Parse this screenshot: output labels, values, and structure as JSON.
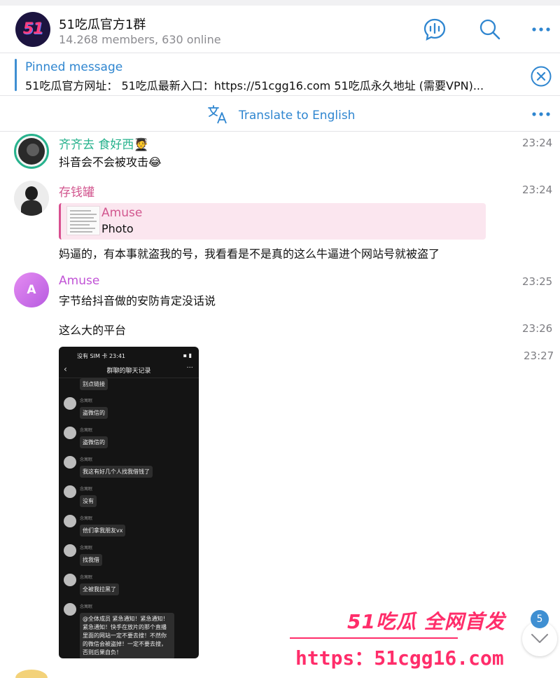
{
  "header": {
    "logo_text": "51",
    "title": "51吃瓜官方1群",
    "subtitle": "14.268 members, 630 online",
    "icons": [
      "voice-chat-icon",
      "search-icon",
      "more-icon"
    ]
  },
  "pinned": {
    "title": "Pinned message",
    "text": "51吃瓜官方网址： 51吃瓜最新入口：https://51cgg16.com 51吃瓜永久地址 (需要VPN)..."
  },
  "translate": {
    "label": "Translate to English"
  },
  "messages": [
    {
      "sender": "齐齐去 食好西🧑‍🎓",
      "text": "抖音会不会被攻击😂",
      "time": "23:24",
      "name_color": "#27b28d"
    },
    {
      "sender": "存钱罐",
      "reply_name": "Amuse",
      "reply_text": "Photo",
      "text": "妈逼的，有本事就盗我的号，我看看是不是真的这么牛逼进个网站号就被盗了",
      "time": "23:24",
      "name_color": "#d2578f"
    },
    {
      "sender": "Amuse",
      "avatar_letter": "A",
      "text": "字节给抖音做的安防肯定没话说",
      "time": "23:25",
      "name_color": "#c153d6"
    },
    {
      "text": "这么大的平台",
      "time": "23:26"
    },
    {
      "time": "23:27"
    }
  ],
  "screenshot": {
    "status_left": "没有 SIM 卡 23:41",
    "status_right": "▪ ▮",
    "title": "群聊的聊天记录",
    "sender": "念寓眠",
    "bubbles": [
      "别点链接",
      "盗微信的",
      "盗微信的",
      "我这有好几个人找我借钱了",
      "没有",
      "他们拿我朋友vx",
      "找我借",
      "全被我拉黑了",
      "@全体成员 紧急通知！紧急通知！紧急通知！快手在放片的那个直播里面的网站一定不要去搜！不然你的微信会被盗掉！一定不要去搜，否则后果自负！"
    ]
  },
  "watermark": {
    "line1": "51吃瓜 全网首发",
    "line2": "https：51cgg16.com"
  },
  "unread_count": "5"
}
